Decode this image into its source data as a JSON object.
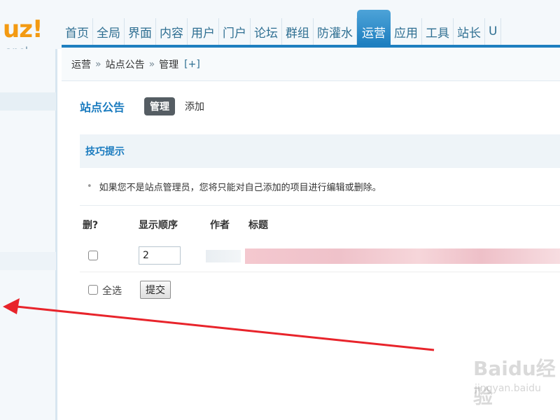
{
  "logo": {
    "main": "uz!",
    "sub": "anel"
  },
  "nav": {
    "items": [
      "首页",
      "全局",
      "界面",
      "内容",
      "用户",
      "门户",
      "论坛",
      "群组",
      "防灌水",
      "运营",
      "应用",
      "工具",
      "站长",
      "U"
    ],
    "active": "运营"
  },
  "breadcrumb": {
    "items": [
      "运营",
      "站点公告",
      "管理"
    ],
    "separator": "»",
    "add": "[+]"
  },
  "page": {
    "title": "站点公告",
    "tabs": {
      "manage": "管理",
      "add": "添加"
    }
  },
  "tips": {
    "title": "技巧提示",
    "bullet": "•",
    "text": "如果您不是站点管理员，您将只能对自己添加的项目进行编辑或删除。"
  },
  "table": {
    "headers": {
      "delete": "删?",
      "order": "显示顺序",
      "author": "作者",
      "title": "标题"
    },
    "rows": [
      {
        "order": "2"
      }
    ]
  },
  "footer": {
    "select_all": "全选",
    "submit": "提交"
  },
  "watermark": {
    "main": "Baidu经验",
    "sub": "jingyan.baidu"
  },
  "colors": {
    "accent": "#1e7fc0",
    "logo": "#f39a12",
    "arrow": "#e8242b"
  }
}
